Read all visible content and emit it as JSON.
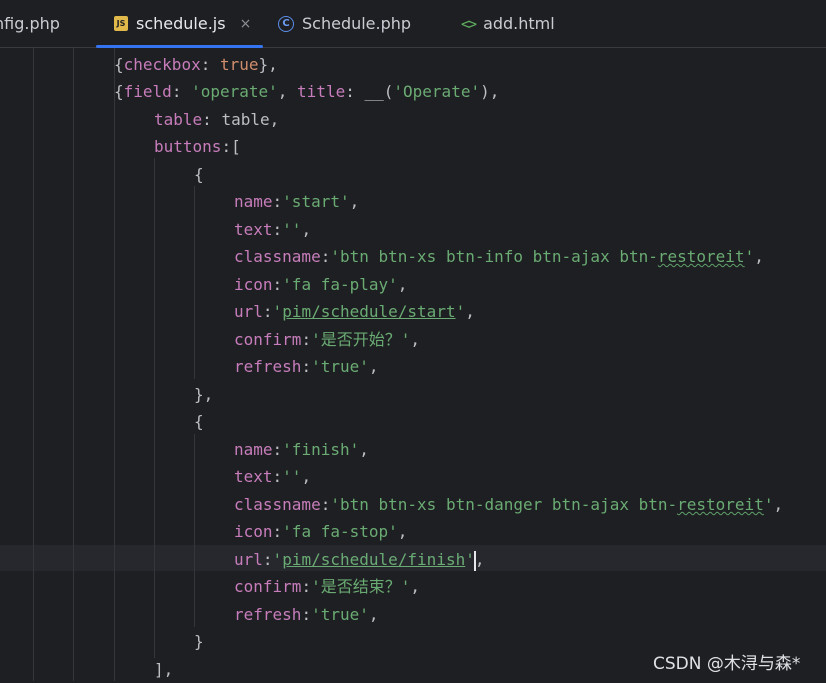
{
  "tabs": [
    {
      "label": "nfig.php",
      "icon": "php-file-icon",
      "active": false
    },
    {
      "label": "schedule.js",
      "icon": "js-file-icon",
      "active": true,
      "close": "×",
      "badge": "JS"
    },
    {
      "label": "Schedule.php",
      "icon": "php-class-icon",
      "active": false,
      "badge": "C"
    },
    {
      "label": "add.html",
      "icon": "html-file-icon",
      "active": false,
      "badge": "<>"
    }
  ],
  "code": {
    "l0": {
      "a": "{",
      "b": "checkbox",
      "c": ": ",
      "d": "true",
      "e": "},"
    },
    "l1": {
      "a": "{",
      "b": "field",
      "c": ": ",
      "d": "'operate'",
      "e": ", ",
      "f": "title",
      "g": ": __(",
      "h": "'Operate'",
      "i": "),"
    },
    "l2": {
      "a": "table",
      "b": ": table,"
    },
    "l3": {
      "a": "buttons",
      "b": ":["
    },
    "l4": {
      "a": "{"
    },
    "l5": {
      "a": "name",
      "b": ":",
      "c": "'start'",
      "d": ","
    },
    "l6": {
      "a": "text",
      "b": ":",
      "c": "''",
      "d": ","
    },
    "l7": {
      "a": "classname",
      "b": ":",
      "c": "'btn btn-xs btn-info btn-ajax btn-",
      "d": "restoreit",
      "e": "'",
      "f": ","
    },
    "l8": {
      "a": "icon",
      "b": ":",
      "c": "'fa fa-play'",
      "d": ","
    },
    "l9": {
      "a": "url",
      "b": ":",
      "c": "'",
      "d": "pim/schedule/start",
      "e": "'",
      "f": ","
    },
    "l10": {
      "a": "confirm",
      "b": ":",
      "c": "'是否开始？'",
      "d": ","
    },
    "l11": {
      "a": "refresh",
      "b": ":",
      "c": "'true'",
      "d": ","
    },
    "l12": {
      "a": "},"
    },
    "l13": {
      "a": "{"
    },
    "l14": {
      "a": "name",
      "b": ":",
      "c": "'finish'",
      "d": ","
    },
    "l15": {
      "a": "text",
      "b": ":",
      "c": "''",
      "d": ","
    },
    "l16": {
      "a": "classname",
      "b": ":",
      "c": "'btn btn-xs btn-danger btn-ajax btn-",
      "d": "restoreit",
      "e": "'",
      "f": ","
    },
    "l17": {
      "a": "icon",
      "b": ":",
      "c": "'fa fa-stop'",
      "d": ","
    },
    "l18": {
      "a": "url",
      "b": ":",
      "c": "'",
      "d": "pim/schedule/finish",
      "e": "'",
      "f": ","
    },
    "l19": {
      "a": "confirm",
      "b": ":",
      "c": "'是否结束？'",
      "d": ","
    },
    "l20": {
      "a": "refresh",
      "b": ":",
      "c": "'true'",
      "d": ","
    },
    "l21": {
      "a": "}"
    },
    "l22": {
      "a": "],"
    }
  },
  "watermark": "CSDN @木浔与森*",
  "colors": {
    "background": "#1e1f22",
    "keyword": "#c77dbb",
    "string": "#6aab73",
    "boolean": "#cf8e6d",
    "accent": "#3574f0"
  }
}
